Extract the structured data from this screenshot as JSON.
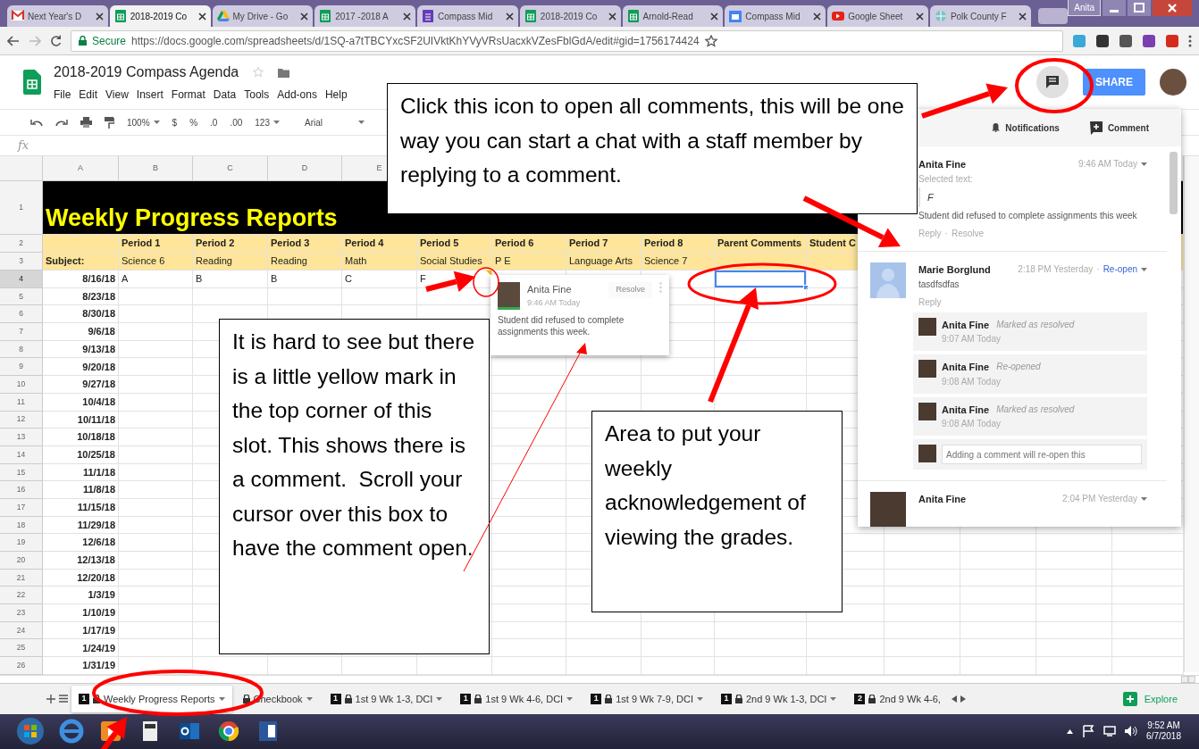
{
  "browser": {
    "tabs": [
      {
        "kind": "mail",
        "title": "Next Year's D",
        "selected": false
      },
      {
        "kind": "sheets",
        "title": "2018-2019 Co",
        "selected": true
      },
      {
        "kind": "drive",
        "title": "My Drive - Go",
        "selected": false
      },
      {
        "kind": "sheets",
        "title": "2017 -2018 A",
        "selected": false
      },
      {
        "kind": "forms",
        "title": "Compass Mid",
        "selected": false
      },
      {
        "kind": "sheets",
        "title": "2018-2019 Co",
        "selected": false
      },
      {
        "kind": "sheets",
        "title": "Arnold-Read",
        "selected": false
      },
      {
        "kind": "calendar",
        "title": "Compass Mid",
        "selected": false
      },
      {
        "kind": "video",
        "title": "Google Sheet",
        "selected": false
      },
      {
        "kind": "site",
        "title": "Polk County F",
        "selected": false
      }
    ],
    "profile": "Anita",
    "secure_label": "Secure",
    "url": "https://docs.google.com/spreadsheets/d/1SQ-a7tTBCYxcSF2UIVktKhYVyVRsUacxkVZesFblGdA/edit#gid=1756174424"
  },
  "app": {
    "title": "2018-2019 Compass Agenda",
    "menu": [
      "File",
      "Edit",
      "View",
      "Insert",
      "Format",
      "Data",
      "Tools",
      "Add-ons",
      "Help"
    ],
    "share_label": "SHARE",
    "toolbar": [
      "100%",
      "$",
      "%",
      ".0",
      ".00",
      "123",
      "Arial"
    ],
    "formula_label": "fx"
  },
  "sheet": {
    "column_letters": [
      "A",
      "B",
      "C",
      "D",
      "E"
    ],
    "title": "Weekly Progress Reports",
    "title_row_number": "1",
    "period_row": {
      "number": "2",
      "labels": [
        "Period 1",
        "Period 2",
        "Period 3",
        "Period 4",
        "Period 5",
        "Period 6",
        "Period 7",
        "Period 8",
        "Parent Comments",
        "Student C"
      ]
    },
    "subject_row": {
      "number": "3",
      "subject_label": "Subject:",
      "labels": [
        "Science 6",
        "Reading",
        "Reading",
        "Math",
        "Social Studies",
        "P E",
        "Language Arts",
        "Science 7"
      ]
    },
    "rows": [
      {
        "number": "4",
        "date": "8/16/18",
        "grades": [
          {
            "text": "A",
            "comment": false
          },
          {
            "text": "B",
            "comment": false
          },
          {
            "text": "B",
            "comment": false
          },
          {
            "text": "C",
            "comment": false
          },
          {
            "text": "F",
            "comment": true
          }
        ],
        "acknowledgement_selected": true
      },
      {
        "number": "5",
        "date": "8/23/18",
        "acknowledgement_selected": false
      },
      {
        "number": "6",
        "date": "8/30/18",
        "acknowledgement_selected": false
      },
      {
        "number": "7",
        "date": "9/6/18",
        "acknowledgement_selected": false
      },
      {
        "number": "8",
        "date": "9/13/18",
        "acknowledgement_selected": false
      },
      {
        "number": "9",
        "date": "9/20/18",
        "acknowledgement_selected": false
      },
      {
        "number": "10",
        "date": "9/27/18",
        "acknowledgement_selected": false
      },
      {
        "number": "11",
        "date": "10/4/18",
        "acknowledgement_selected": false
      },
      {
        "number": "12",
        "date": "10/11/18",
        "acknowledgement_selected": false
      },
      {
        "number": "13",
        "date": "10/18/18",
        "acknowledgement_selected": false
      },
      {
        "number": "14",
        "date": "10/25/18",
        "acknowledgement_selected": false
      },
      {
        "number": "15",
        "date": "11/1/18",
        "acknowledgement_selected": false
      },
      {
        "number": "16",
        "date": "11/8/18",
        "acknowledgement_selected": false
      },
      {
        "number": "17",
        "date": "11/15/18",
        "acknowledgement_selected": false
      },
      {
        "number": "18",
        "date": "11/29/18",
        "acknowledgement_selected": false
      },
      {
        "number": "19",
        "date": "12/6/18",
        "acknowledgement_selected": false
      },
      {
        "number": "20",
        "date": "12/13/18",
        "acknowledgement_selected": false
      },
      {
        "number": "21",
        "date": "12/20/18",
        "acknowledgement_selected": false
      },
      {
        "number": "22",
        "date": "1/3/19",
        "acknowledgement_selected": false
      },
      {
        "number": "23",
        "date": "1/10/19",
        "acknowledgement_selected": false
      },
      {
        "number": "24",
        "date": "1/17/19",
        "acknowledgement_selected": false
      },
      {
        "number": "25",
        "date": "1/24/19",
        "acknowledgement_selected": false
      },
      {
        "number": "26",
        "date": "1/31/19",
        "acknowledgement_selected": false
      }
    ]
  },
  "sheet_tabs": [
    {
      "number": "1",
      "label": "Weekly Progress Reports",
      "selected": true
    },
    {
      "label": "Checkbook",
      "selected": false
    },
    {
      "number": "1",
      "label": "1st 9 Wk 1-3, DCI",
      "selected": false
    },
    {
      "number": "1",
      "label": "1st 9 Wk 4-6, DCI",
      "selected": false
    },
    {
      "number": "1",
      "label": "1st 9 Wk 7-9, DCI",
      "selected": false
    },
    {
      "number": "1",
      "label": "2nd 9 Wk 1-3, DCI",
      "selected": false
    },
    {
      "number": "2",
      "label": "2nd 9 Wk 4-6,",
      "selected": false
    }
  ],
  "explore_label": "Explore",
  "hover_comment": {
    "author": "Anita Fine",
    "time": "9:46 AM Today",
    "resolve_label": "Resolve",
    "body": "Student did refused to complete assignments this week."
  },
  "comments_panel": {
    "notifications_label": "Notifications",
    "comment_label": "Comment",
    "separator": "·",
    "threads": [
      {
        "kind": "open",
        "author": "Anita Fine",
        "time": "9:46 AM Today",
        "selected_label": "Selected text:",
        "quote": "F",
        "body": "Student did refused to complete assignments this week",
        "actions": [
          "Reply",
          "Resolve"
        ]
      },
      {
        "kind": "resolved",
        "author": "Marie Borglund",
        "time": "2:18 PM Yesterday",
        "reopen_label": "Re-open",
        "body": "tasdfsdfas",
        "actions": [
          "Reply"
        ],
        "replies": [
          {
            "author": "Anita Fine",
            "status": "Marked as resolved",
            "time": "9:07 AM Today"
          },
          {
            "author": "Anita Fine",
            "status": "Re-opened",
            "time": "9:08 AM Today"
          },
          {
            "author": "Anita Fine",
            "status": "Marked as resolved",
            "time": "9:08 AM Today"
          }
        ],
        "reply_placeholder": "Adding a comment will re-open this"
      },
      {
        "kind": "cut",
        "author": "Anita Fine",
        "time": "2:04 PM Yesterday"
      }
    ]
  },
  "callouts": [
    "Click this icon to open all comments, this will be one way you can start a chat with a staff member by replying to a comment.",
    "It is hard to see but there is a little yellow mark in the top corner of this slot. This shows there is a comment.  Scroll your cursor over this box to have the comment open.",
    "Area to put your weekly acknowledgement of viewing the grades."
  ],
  "taskbar": {
    "time": "9:52 AM",
    "date": "6/7/2018"
  }
}
